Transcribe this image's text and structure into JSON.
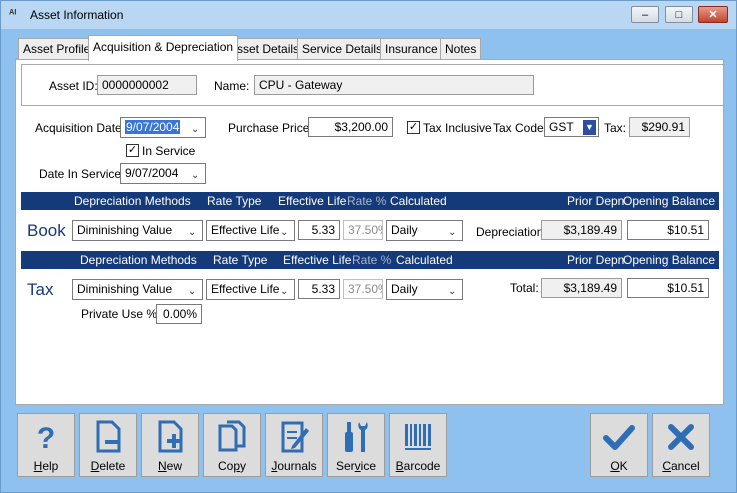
{
  "window": {
    "title": "Asset Information",
    "minimize_glyph": "–",
    "maximize_glyph": "□",
    "close_glyph": "✕",
    "app_icon_glyph": "ᴬᴵ"
  },
  "tabs": [
    "Asset Profile",
    "Acquisition & Depreciation",
    "Asset Details",
    "Service Details",
    "Insurance",
    "Notes"
  ],
  "identity": {
    "asset_id_label": "Asset ID:",
    "asset_id_value": "0000000002",
    "name_label": "Name:",
    "name_value": "CPU - Gateway"
  },
  "acquisition": {
    "date_label": "Acquisition Date:",
    "date_value": "9/07/2004",
    "purchase_price_label": "Purchase Price:",
    "purchase_price_value": "$3,200.00",
    "tax_inclusive_label": "Tax Inclusive",
    "tax_inclusive_checked": true,
    "tax_code_label": "Tax Code:",
    "tax_code_value": "GST",
    "tax_label": "Tax:",
    "tax_value": "$290.91",
    "in_service_label": "In Service",
    "in_service_checked": true,
    "date_in_service_label": "Date In Service:",
    "date_in_service_value": "9/07/2004",
    "check_glyph": "✓",
    "chevron_glyph": "⌄"
  },
  "depreciation_headers": {
    "methods": "Depreciation Methods",
    "rate_type": "Rate Type",
    "effective_life": "Effective Life",
    "rate_pct": "Rate %",
    "calculated": "Calculated",
    "prior_depn": "Prior Depn",
    "opening_balance": "Opening Balance"
  },
  "book": {
    "label": "Book",
    "method": "Diminishing Value",
    "rate_type": "Effective Life",
    "effective_life": "5.33",
    "rate_pct": "37.50%",
    "calculated": "Daily",
    "summary_label": "Depreciation:",
    "prior_depn": "$3,189.49",
    "opening_balance": "$10.51"
  },
  "tax": {
    "label": "Tax",
    "method": "Diminishing Value",
    "rate_type": "Effective Life",
    "effective_life": "5.33",
    "rate_pct": "37.50%",
    "calculated": "Daily",
    "summary_label": "Total:",
    "prior_depn": "$3,189.49",
    "opening_balance": "$10.51",
    "private_use_label": "Private Use %:",
    "private_use_value": "0.00%"
  },
  "toolbar": {
    "help": {
      "key": "H",
      "rest": "elp"
    },
    "delete": {
      "key": "D",
      "rest": "elete"
    },
    "new": {
      "key": "N",
      "rest": "ew"
    },
    "copy": {
      "pre": "Co",
      "key": "p",
      "rest": "y"
    },
    "journals": {
      "key": "J",
      "rest": "ournals"
    },
    "service": {
      "pre": "Ser",
      "key": "v",
      "rest": "ice"
    },
    "barcode": {
      "key": "B",
      "rest": "arcode"
    },
    "ok": {
      "key": "O",
      "rest": "K"
    },
    "cancel": {
      "key": "C",
      "rest": "ancel"
    }
  },
  "colors": {
    "accent": "#153a79",
    "icon_blue": "#2f6db5",
    "selection": "#3875d7"
  }
}
